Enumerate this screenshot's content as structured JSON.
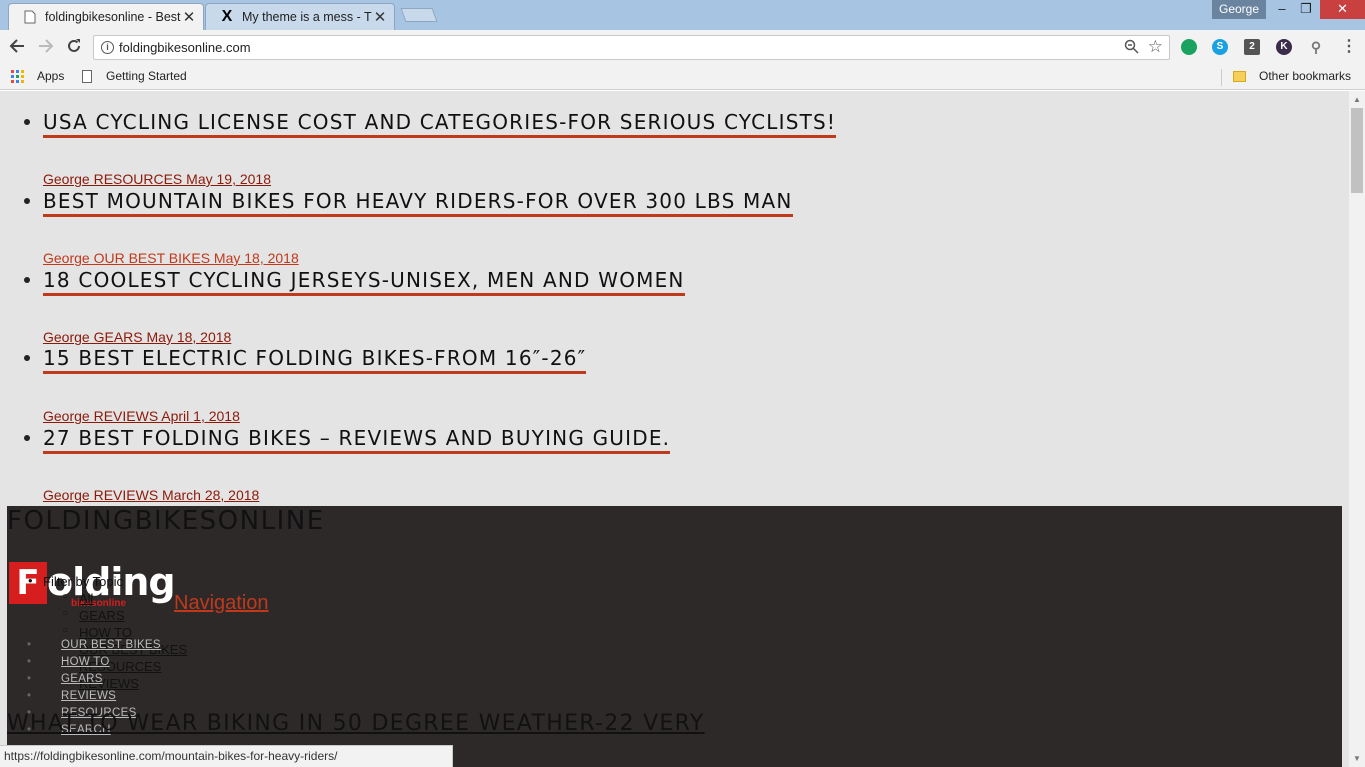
{
  "browser": {
    "tabs": [
      {
        "title": "foldingbikesonline - Best",
        "active": true
      },
      {
        "title": "My theme is a mess - The",
        "active": false
      }
    ],
    "profile_name": "George",
    "window_controls": {
      "minimize": "–",
      "restore": "❐",
      "close": "✕"
    },
    "url": "foldingbikesonline.com",
    "bookmarks": {
      "apps": "Apps",
      "getting_started": "Getting Started",
      "other": "Other bookmarks"
    },
    "status_url": "https://foldingbikesonline.com/mountain-bikes-for-heavy-riders/",
    "icons": [
      "back-icon",
      "forward-icon",
      "reload-icon",
      "info-icon",
      "zoom-icon",
      "star-icon",
      "close-icon"
    ],
    "extensions": [
      {
        "name": "hangouts-icon",
        "color": "#1aa260",
        "glyph": ""
      },
      {
        "name": "skype-icon",
        "color": "#1ba1e2",
        "glyph": "S"
      },
      {
        "name": "badge-2-icon",
        "color": "#555555",
        "glyph": "2"
      },
      {
        "name": "k-extension-icon",
        "color": "#3a2c4a",
        "glyph": "K"
      },
      {
        "name": "bike-extension-icon",
        "color": "#888888",
        "glyph": "⚲"
      }
    ]
  },
  "posts": [
    {
      "title": "USA CYCLING LICENSE COST AND CATEGORIES-FOR SERIOUS CYCLISTS!",
      "meta": "George RESOURCES May 19, 2018"
    },
    {
      "title": "BEST MOUNTAIN BIKES FOR HEAVY RIDERS-FOR OVER 300 LBS MAN",
      "meta": "George OUR BEST BIKES May 18, 2018"
    },
    {
      "title": "18 COOLEST CYCLING JERSEYS-UNISEX, MEN AND WOMEN",
      "meta": "George GEARS May 18, 2018"
    },
    {
      "title": "15 BEST ELECTRIC FOLDING BIKES-FROM 16″-26″",
      "meta": "George REVIEWS April 1, 2018"
    },
    {
      "title": "27 BEST FOLDING BIKES – REVIEWS AND BUYING GUIDE.",
      "meta": "George REVIEWS March 28, 2018"
    }
  ],
  "footer": {
    "site_name": "FOLDINGBIKESONLINE",
    "logo_text": "Folding",
    "logo_sub": "bikesonline",
    "navigation_link": "Navigation",
    "filter_label": "Filter by Topic",
    "filter_items": [
      "All",
      "GEARS",
      "HOW TO",
      "OUR BEST BIKES",
      "RESOURCES",
      "REVIEWS"
    ],
    "menu_items": [
      "OUR BEST BIKES",
      "HOW TO",
      "GEARS",
      "REVIEWS",
      "RESOURCES",
      "SEARCH"
    ],
    "partial_post_title": "WHAT TO WEAR BIKING IN 50 DEGREE WEATHER-22 VERY"
  },
  "colors": {
    "accent": "#c0391b",
    "footer_bg": "#2d2929",
    "page_bg": "#e4e4e4"
  }
}
